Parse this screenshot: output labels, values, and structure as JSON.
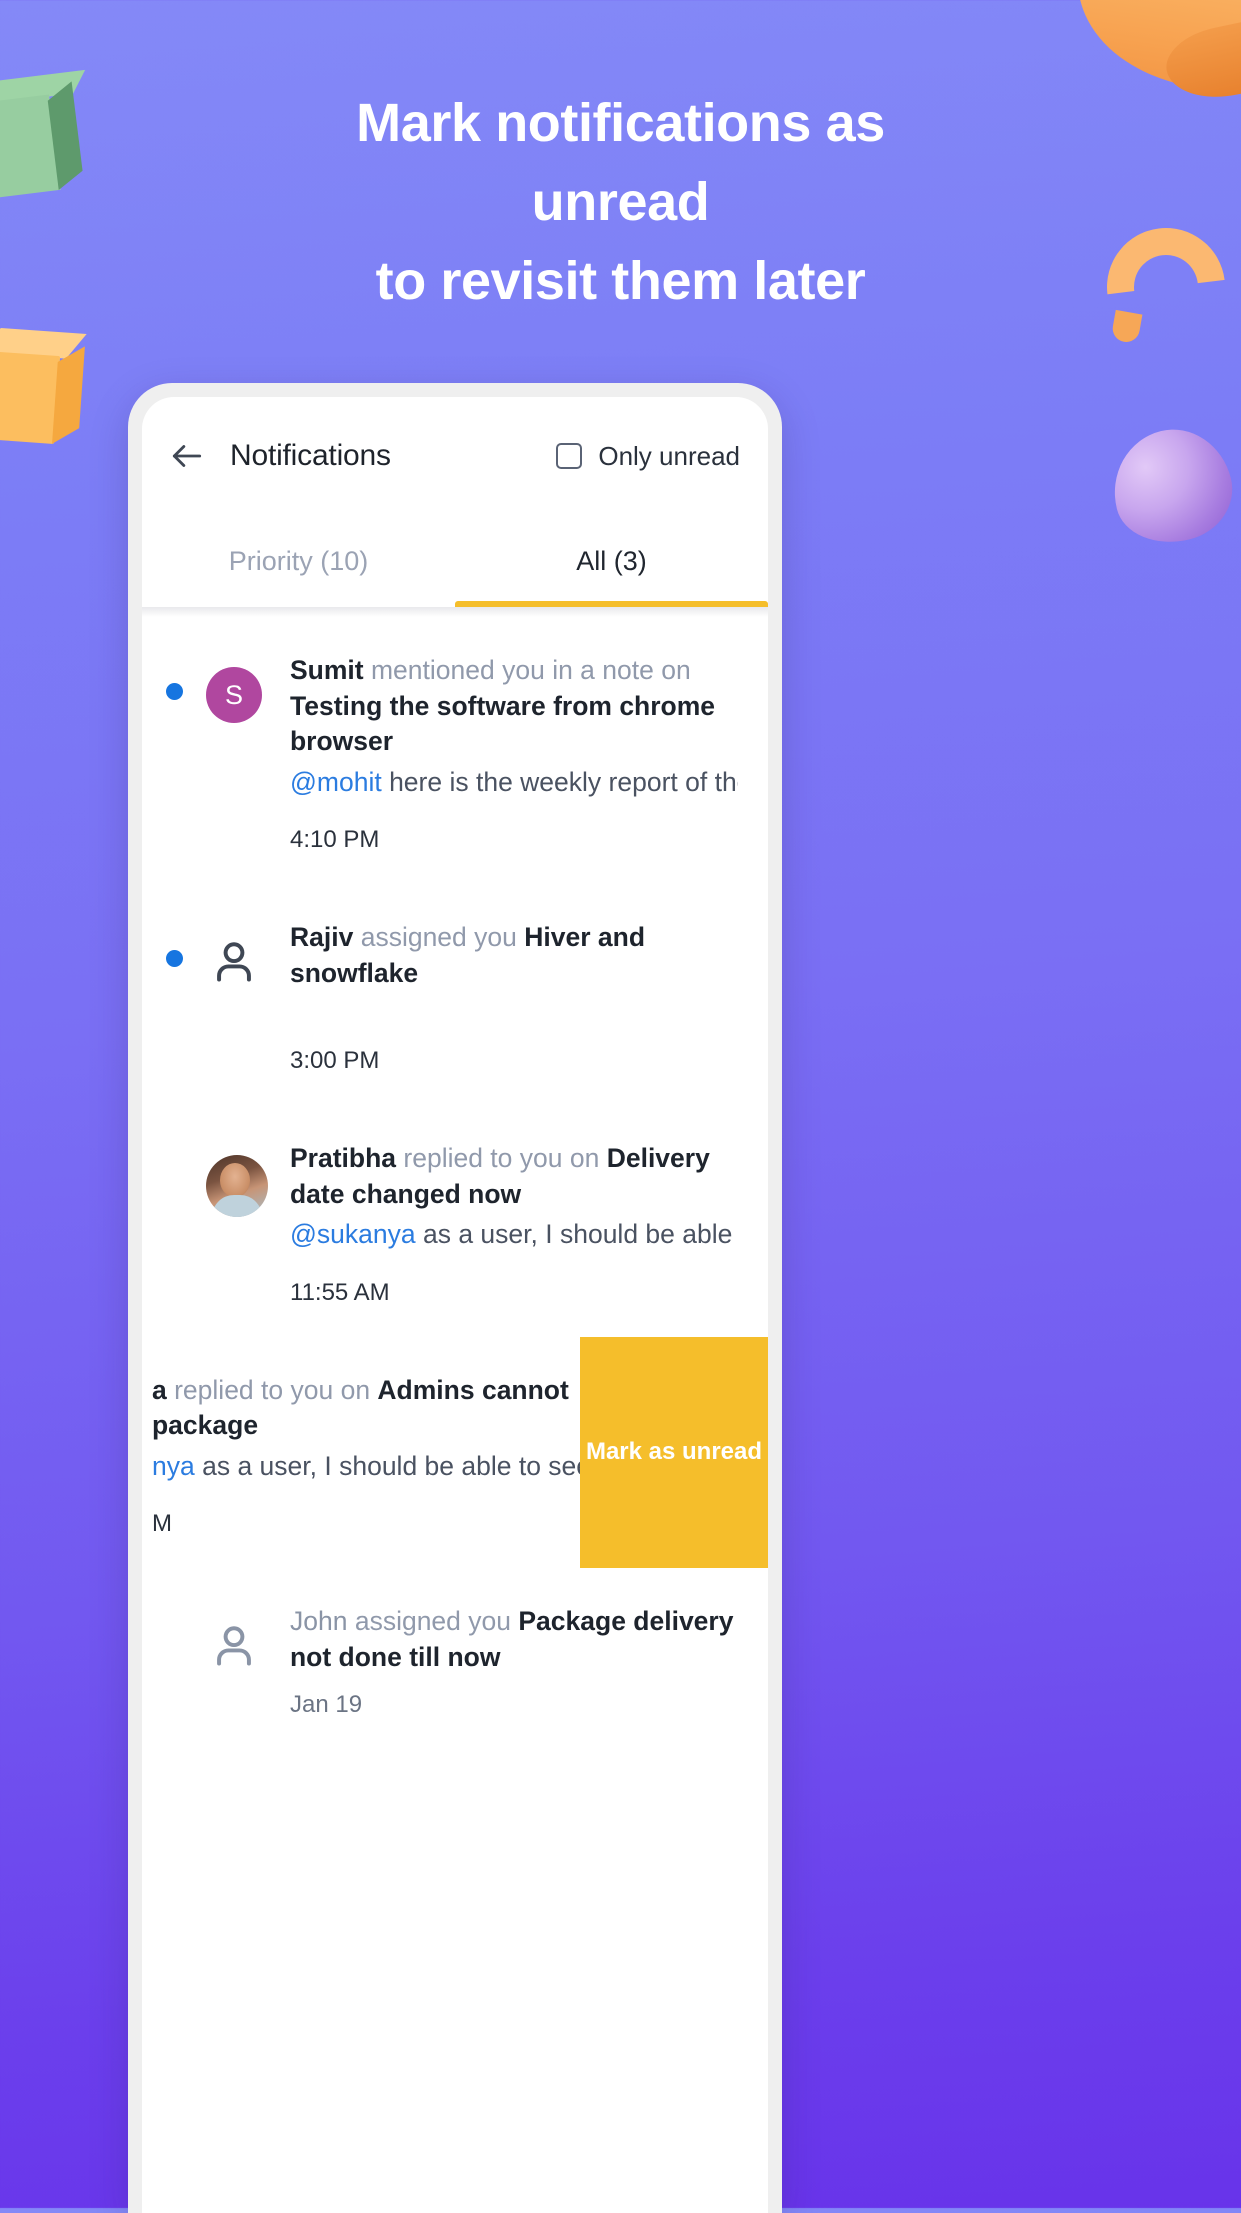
{
  "headline": {
    "line1": "Mark notifications as",
    "line2": "unread",
    "line3": "to revisit them later"
  },
  "colors": {
    "background_top": "#8489F7",
    "background_bottom": "#6833EA",
    "accent_yellow": "#F5BE2B",
    "unread_dot_blue": "#1675E0",
    "mention_blue": "#2B7CE0",
    "avatar_purple": "#B0479F"
  },
  "app": {
    "header": {
      "back_icon": "arrow-left-icon",
      "title": "Notifications",
      "only_unread_label": "Only unread",
      "only_unread_checked": false
    },
    "tabs": [
      {
        "label": "Priority (10)",
        "active": false
      },
      {
        "label": "All (3)",
        "active": true
      }
    ],
    "notifications": [
      {
        "unread": true,
        "avatar_type": "initial",
        "avatar_initial": "S",
        "actor": "Sumit",
        "verb": " mentioned you in a note on ",
        "subject": "Testing the software from chrome browser",
        "mention": "@mohit",
        "preview": " here is the weekly report of the la…",
        "timestamp": "4:10 PM"
      },
      {
        "unread": true,
        "avatar_type": "person",
        "actor": "Rajiv",
        "verb": " assigned you ",
        "subject": "Hiver and snowflake",
        "mention": "",
        "preview": "",
        "timestamp": "3:00 PM"
      },
      {
        "unread": false,
        "avatar_type": "photo",
        "actor": "Pratibha",
        "verb": " replied to you on ",
        "subject": "Delivery date changed now",
        "mention": "@sukanya",
        "preview": " as a user, I should be able to see t…",
        "timestamp": "11:55 AM"
      },
      {
        "unread": false,
        "swiped": true,
        "avatar_type": "none",
        "actor": "a",
        "verb": " replied to you on ",
        "subject": "Admins cannot package",
        "mention": "nya",
        "preview": " as a user, I should be able to see trasn…",
        "timestamp": "M",
        "action_label": "Mark as unread"
      },
      {
        "unread": false,
        "avatar_type": "person",
        "actor": "John",
        "actor_muted": true,
        "verb": " assigned you ",
        "subject": "Package delivery not done till now",
        "mention": "",
        "preview": "",
        "timestamp": "Jan 19"
      }
    ]
  }
}
